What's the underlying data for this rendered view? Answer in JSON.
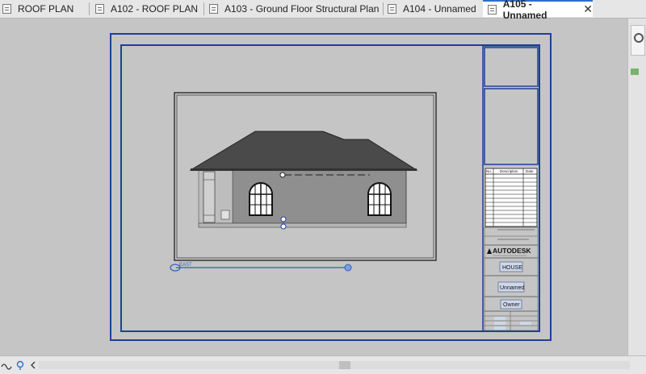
{
  "tabs": [
    {
      "label": "ROOF PLAN",
      "active": false
    },
    {
      "label": "A102 - ROOF PLAN",
      "active": false
    },
    {
      "label": "A103 - Ground Floor Structural Plan",
      "active": false
    },
    {
      "label": "A104 - Unnamed",
      "active": false
    },
    {
      "label": "A105 - Unnamed",
      "active": true
    }
  ],
  "close_glyph": "✕",
  "sheet": {
    "logo": "AUTODESK",
    "project_name": "HOUSE",
    "sheet_name": "Unnamed",
    "owner": "Owner",
    "revision_headers": [
      "No.",
      "Description",
      "Date"
    ]
  },
  "elevation_tag": "EAST",
  "colors": {
    "sheet_border": "#1f3f9a",
    "accent": "#2f6fc9",
    "roof": "#4a4a4a",
    "wall": "#8f8f8f"
  },
  "icons": [
    "view-icon",
    "close-icon",
    "bulb-icon",
    "scroll-left-icon"
  ]
}
